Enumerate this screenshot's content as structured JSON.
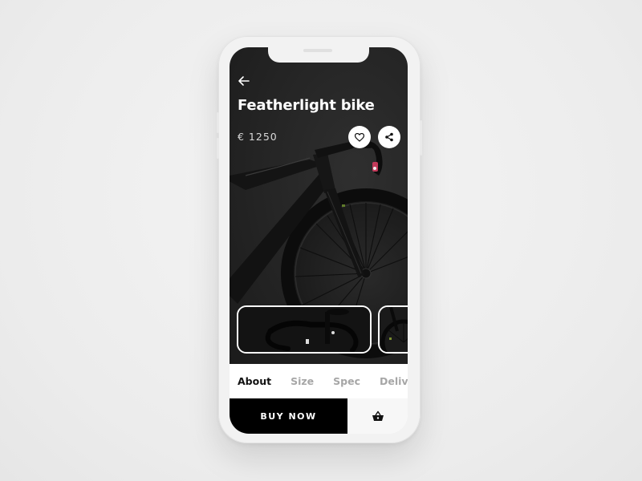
{
  "product": {
    "title": "Featherlight bike",
    "price": "€ 1250"
  },
  "actions": {
    "back_icon": "arrow-left-icon",
    "favorite_icon": "heart-icon",
    "share_icon": "share-icon"
  },
  "gallery": {
    "thumbnails": [
      {
        "name": "handlebar-closeup"
      },
      {
        "name": "front-wheel-closeup"
      }
    ]
  },
  "tabs": [
    {
      "label": "About",
      "active": true
    },
    {
      "label": "Size",
      "active": false
    },
    {
      "label": "Spec",
      "active": false
    },
    {
      "label": "Delive",
      "active": false
    }
  ],
  "footer": {
    "buy_label": "BUY NOW",
    "cart_icon": "basket-icon"
  },
  "colors": {
    "primary": "#000000",
    "hero_bg": "#242424",
    "tab_inactive": "#a6a6a6",
    "background": "#ececec"
  }
}
